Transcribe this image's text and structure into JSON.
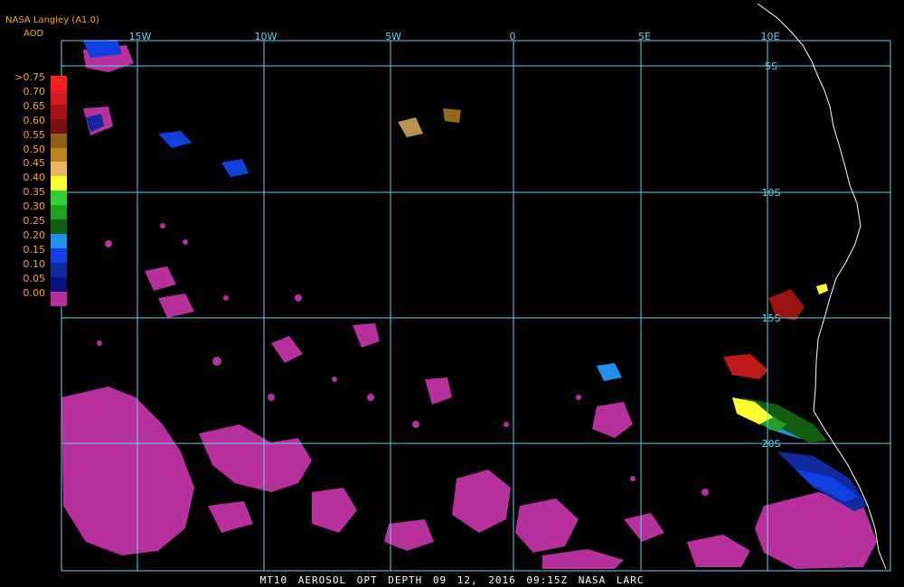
{
  "header": {
    "title": "NASA Langley (A1.0)",
    "subtitle": "AOD"
  },
  "legend": {
    "labels": [
      ">0.75",
      "0.70",
      "0.65",
      "0.60",
      "0.55",
      "0.50",
      "0.45",
      "0.40",
      "0.35",
      "0.30",
      "0.25",
      "0.20",
      "0.15",
      "0.10",
      "0.05",
      "0.00"
    ],
    "colors": [
      "#ff2020",
      "#d41c1c",
      "#a81414",
      "#7a1010",
      "#8a6210",
      "#b8861e",
      "#e8b860",
      "#ffff30",
      "#30d030",
      "#22a022",
      "#145e14",
      "#2090e8",
      "#1040e0",
      "#102aa0",
      "#0a1478",
      "#b8309c"
    ]
  },
  "grid": {
    "lon_labels": [
      "15W",
      "10W",
      "5W",
      "0",
      "5E",
      "10E"
    ],
    "lat_labels": [
      "5S",
      "10S",
      "15S",
      "20S"
    ]
  },
  "footer": {
    "text": "MT10  AEROSOL OPT DEPTH  09 12, 2016 09:15Z  NASA LARC"
  },
  "colors": {
    "grid": "#5fd3e8",
    "coastline": "#ffffff",
    "label_text": "#f5a623",
    "low_aod": "#b8309c"
  }
}
